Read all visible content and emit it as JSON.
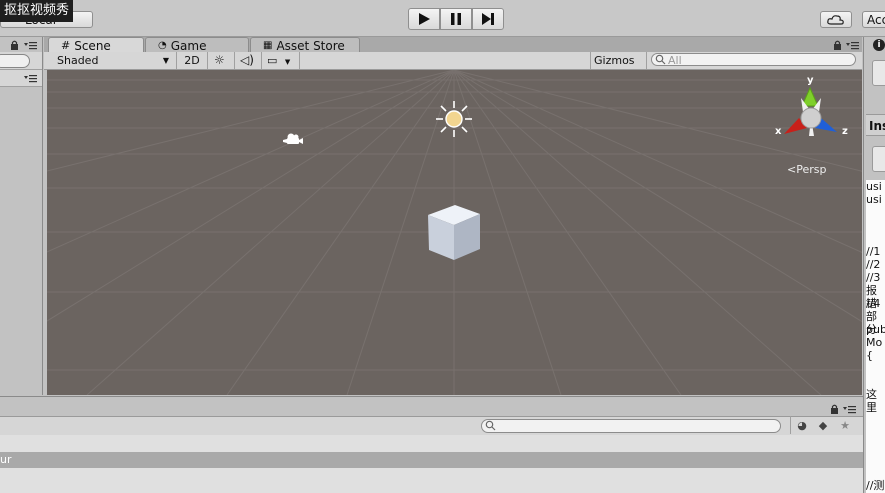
{
  "watermark": "抠抠视频秀",
  "toolbar": {
    "pivot_label": "Local",
    "account_label": "Acc"
  },
  "scene_tabs": [
    {
      "label": "Scene",
      "icon": "grid-icon"
    },
    {
      "label": "Game",
      "icon": "pacman-icon"
    },
    {
      "label": "Asset Store",
      "icon": "bag-icon"
    }
  ],
  "scene_toolbar": {
    "shading_mode": "Shaded",
    "mode_2d": "2D",
    "gizmos_label": "Gizmos",
    "search_placeholder": "All"
  },
  "gizmo": {
    "axis_x": "x",
    "axis_y": "y",
    "axis_z": "z",
    "projection": "Persp"
  },
  "inspector": {
    "title": "Ins",
    "code_lines": [
      "usi",
      "usi",
      "",
      "",
      "",
      "//1",
      "//2",
      "//3",
      "报错",
      "//4",
      "部分",
      "pub",
      "Mo",
      "{",
      "",
      "",
      "这里",
      "",
      "",
      "",
      "",
      "",
      "",
      "//测"
    ]
  },
  "console": {
    "selected_row_text": "ur"
  },
  "colors": {
    "viewport_bg": "#6b6460",
    "axis_x": "#c8201a",
    "axis_y": "#7fcf2a",
    "axis_z": "#1f5fd8"
  }
}
